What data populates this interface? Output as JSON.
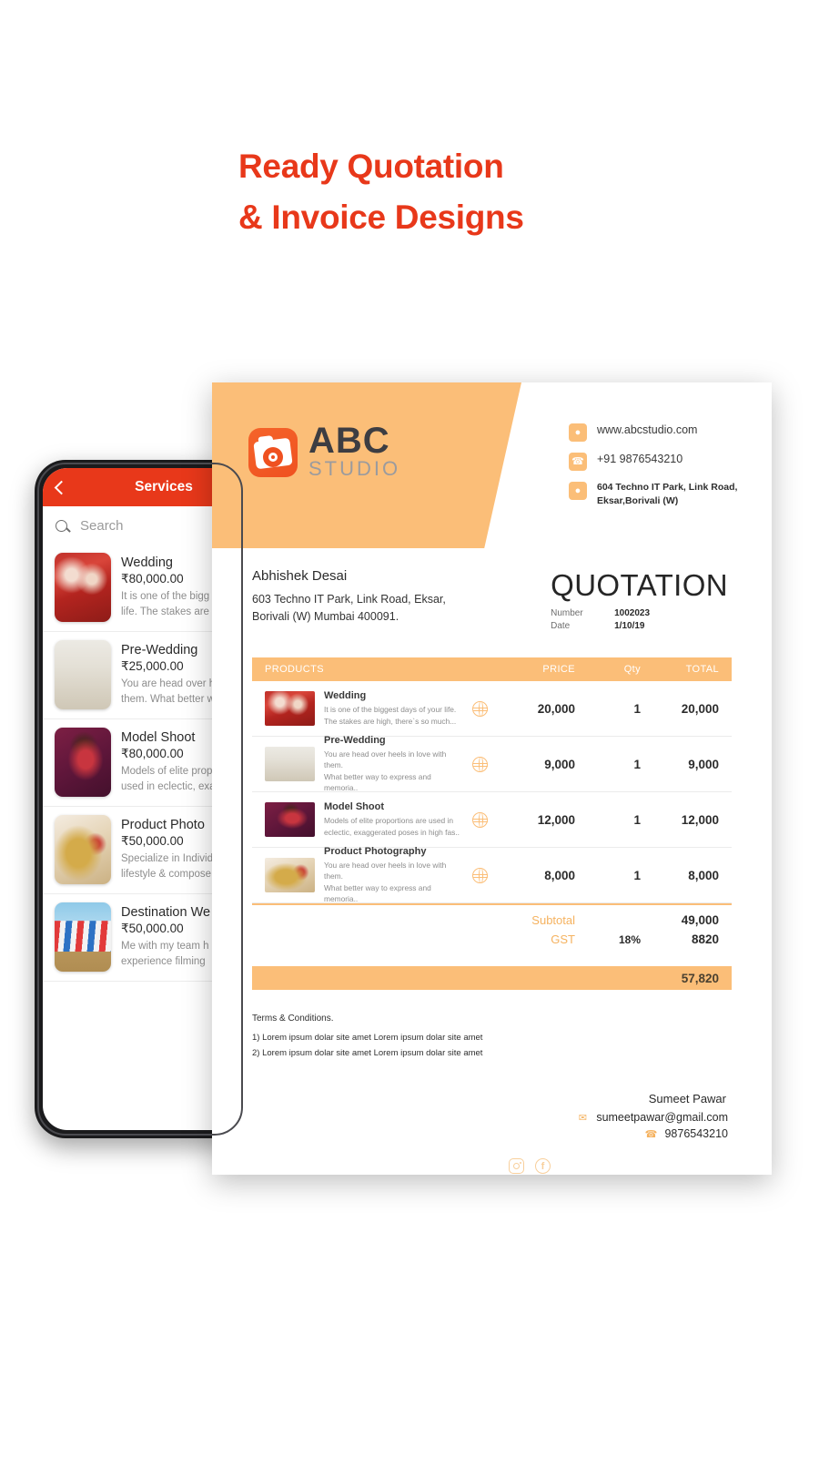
{
  "headline": "Ready Quotation\n& Invoice Designs",
  "colors": {
    "accent_red": "#e8381a",
    "accent_orange": "#fbbe78",
    "logo_orange": "#ef5120"
  },
  "phone": {
    "appbar": {
      "title": "Services",
      "back_icon": "back-chevron-icon"
    },
    "search": {
      "placeholder": "Search",
      "icon": "search-icon"
    },
    "services": [
      {
        "title": "Wedding",
        "price": "₹80,000.00",
        "desc_line1": "It is one of the bigg",
        "desc_line2": "life. The stakes are"
      },
      {
        "title": "Pre-Wedding",
        "price": "₹25,000.00",
        "desc_line1": "You are head over h",
        "desc_line2": "them. What better w"
      },
      {
        "title": "Model Shoot",
        "price": "₹80,000.00",
        "desc_line1": "Models of elite prop",
        "desc_line2": "used in eclectic, exa"
      },
      {
        "title": "Product Photo",
        "price": "₹50,000.00",
        "desc_line1": "Specialize in Individ",
        "desc_line2": "lifestyle & compose"
      },
      {
        "title": "Destination We",
        "price": "₹50,000.00",
        "desc_line1": "Me with my team h",
        "desc_line2": "experience filming"
      }
    ]
  },
  "invoice": {
    "brand": {
      "name": "ABC",
      "sub": "STUDIO"
    },
    "contacts": [
      {
        "icon": "globe-icon",
        "text": "www.abcstudio.com",
        "small": false
      },
      {
        "icon": "phone-icon",
        "text": "+91 9876543210",
        "small": false
      },
      {
        "icon": "location-pin-icon",
        "text": "604 Techno IT Park, Link Road,\nEksar,Borivali (W)",
        "small": true
      }
    ],
    "bill_to": {
      "name": "Abhishek Desai",
      "address": "603 Techno IT Park, Link Road, Eksar,\nBorivali (W) Mumbai 400091."
    },
    "doc": {
      "title": "QUOTATION",
      "number_label": "Number",
      "number_value": "1002023",
      "date_label": "Date",
      "date_value": "1/10/19"
    },
    "table": {
      "headers": {
        "products": "PRODUCTS",
        "price": "PRICE",
        "qty": "Qty",
        "total": "TOTAL"
      },
      "rows": [
        {
          "title": "Wedding",
          "desc": "It is one of the biggest days of your life.\nThe stakes are high, there`s so much...",
          "price": "20,000",
          "qty": "1",
          "total": "20,000"
        },
        {
          "title": "Pre-Wedding",
          "desc": "You are head over heels in love with them.\nWhat better way to express and memoria..",
          "price": "9,000",
          "qty": "1",
          "total": "9,000"
        },
        {
          "title": "Model Shoot",
          "desc": "Models of elite proportions are used in\neclectic, exaggerated poses in high fas..",
          "price": "12,000",
          "qty": "1",
          "total": "12,000"
        },
        {
          "title": "Product Photography",
          "desc": "You are head over heels in love with them.\nWhat better way to express and memoria..",
          "price": "8,000",
          "qty": "1",
          "total": "8,000"
        }
      ],
      "totals": {
        "subtotal_label": "Subtotal",
        "subtotal_value": "49,000",
        "gst_label": "GST",
        "gst_rate": "18%",
        "gst_value": "8820",
        "grand_total": "57,820"
      }
    },
    "terms": {
      "title": "Terms & Conditions.",
      "lines": [
        "1) Lorem ipsum dolar site amet Lorem ipsum dolar site amet",
        "2) Lorem ipsum dolar site amet Lorem ipsum dolar site amet"
      ]
    },
    "footer": {
      "name": "Sumeet Pawar",
      "email": "sumeetpawar@gmail.com",
      "phone": "9876543210",
      "email_icon": "envelope-icon",
      "phone_icon": "phone-icon",
      "social": [
        {
          "name": "instagram-icon",
          "glyph": ""
        },
        {
          "name": "facebook-icon",
          "glyph": "f"
        }
      ]
    }
  }
}
